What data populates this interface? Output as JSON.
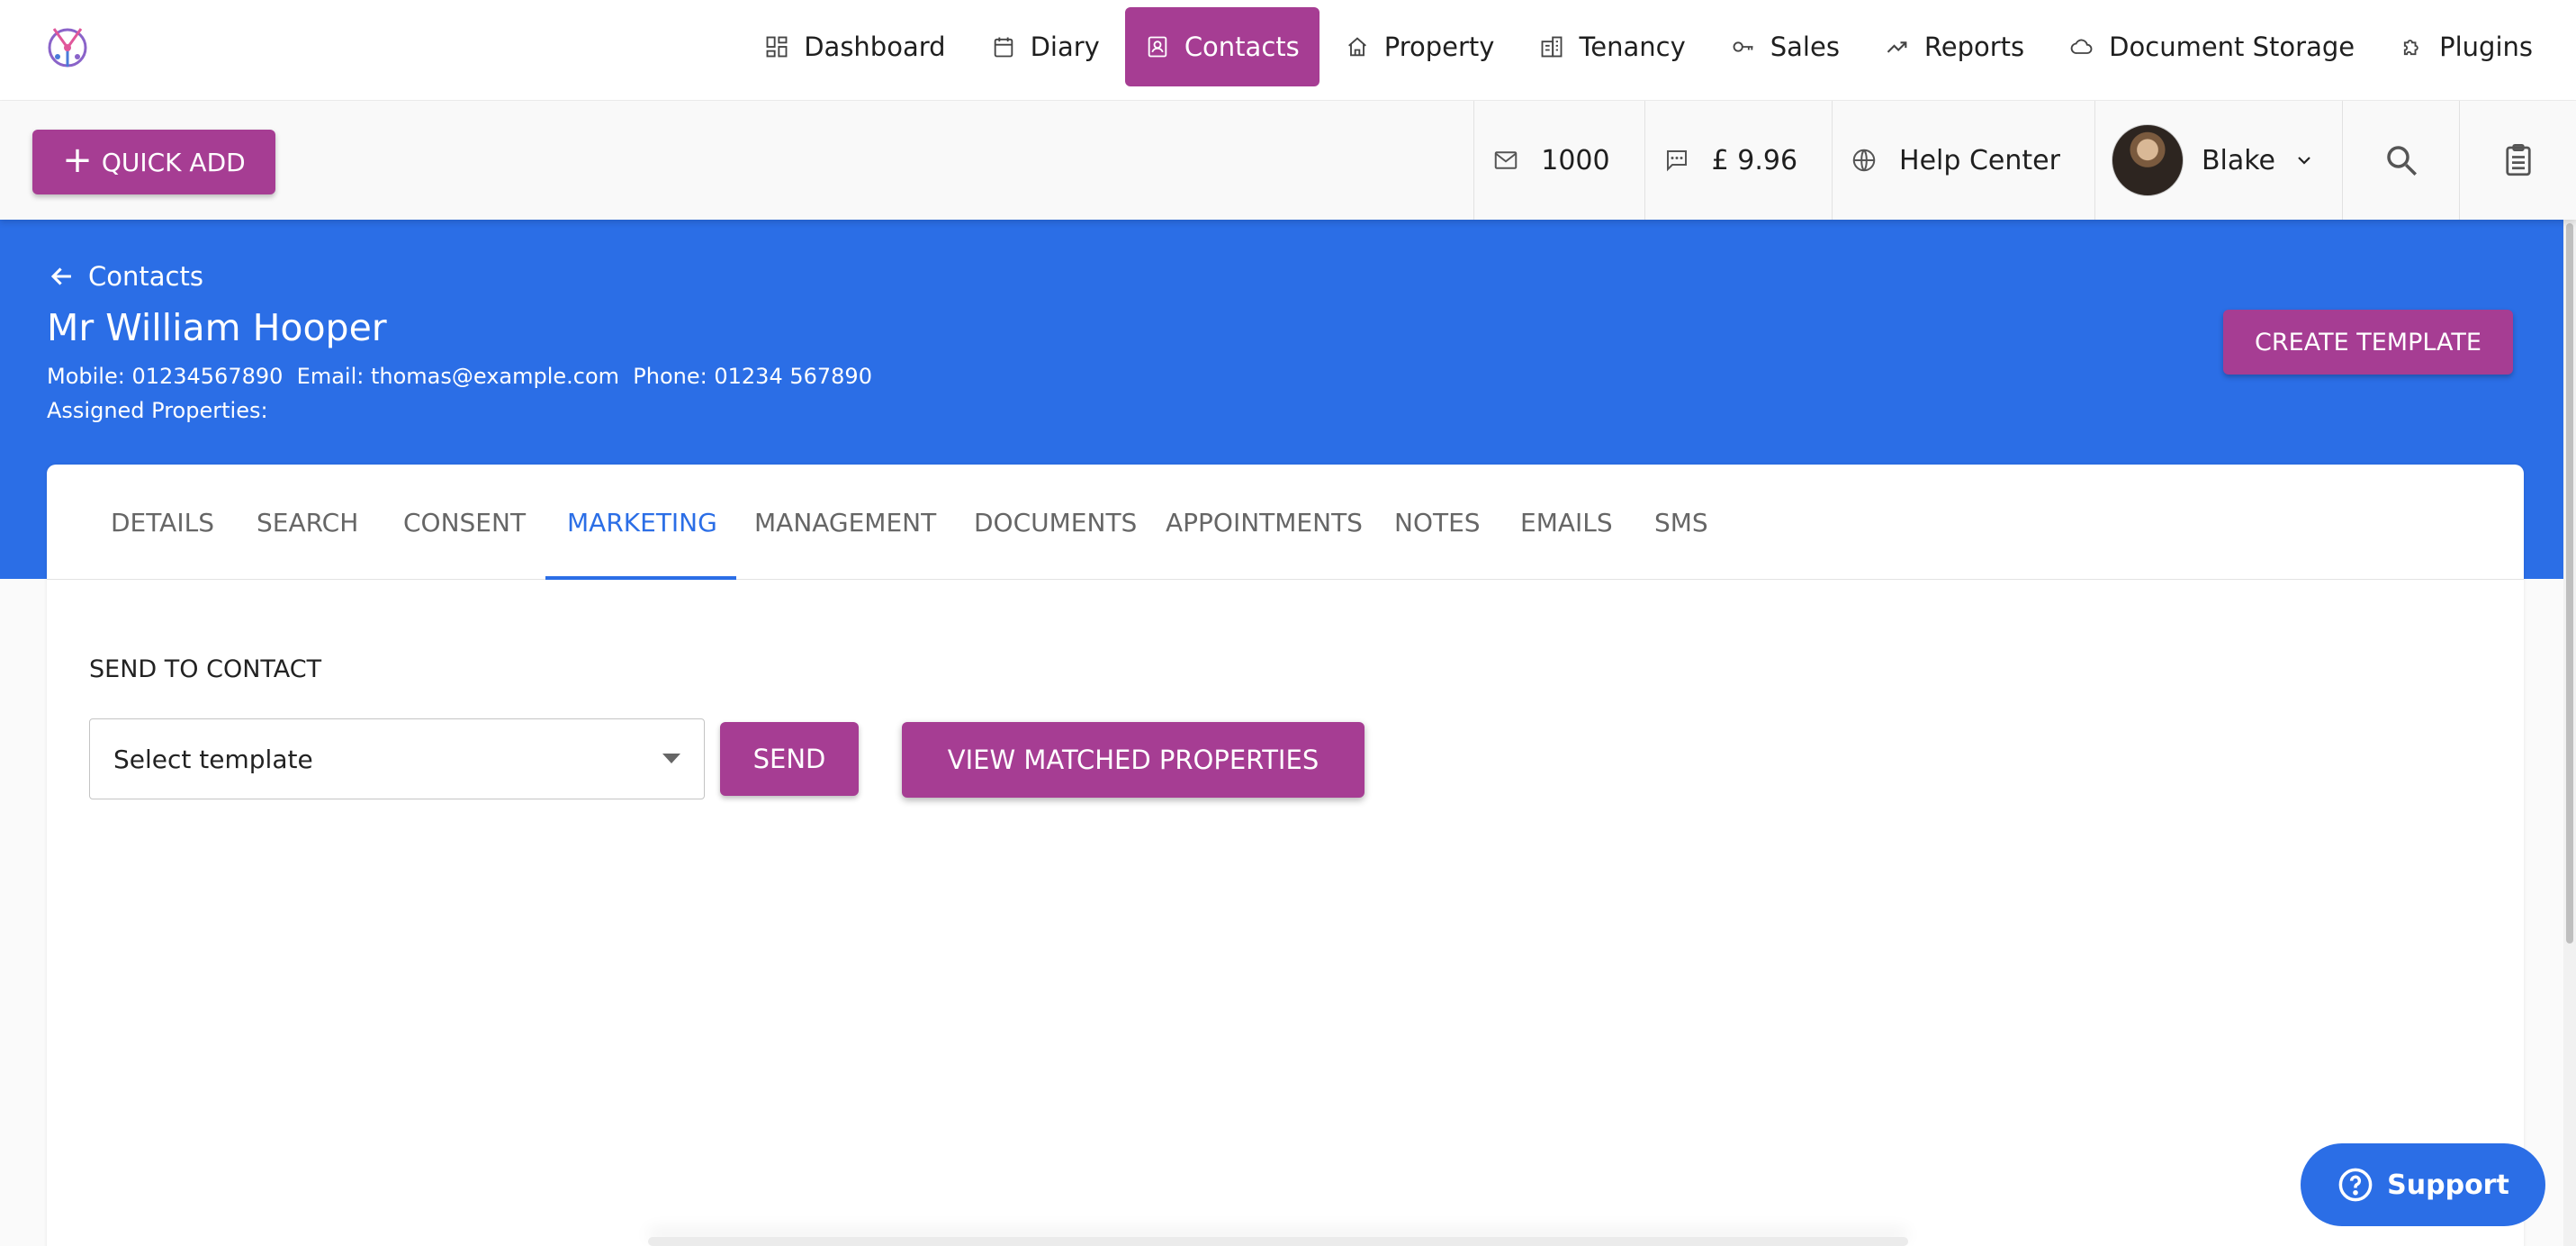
{
  "nav": {
    "items": [
      {
        "label": "Dashboard",
        "icon": "dashboard-icon"
      },
      {
        "label": "Diary",
        "icon": "calendar-icon"
      },
      {
        "label": "Contacts",
        "icon": "contacts-icon",
        "active": true
      },
      {
        "label": "Property",
        "icon": "home-icon"
      },
      {
        "label": "Tenancy",
        "icon": "building-icon"
      },
      {
        "label": "Sales",
        "icon": "key-icon"
      },
      {
        "label": "Reports",
        "icon": "trending-icon"
      },
      {
        "label": "Document Storage",
        "icon": "cloud-icon"
      },
      {
        "label": "Plugins",
        "icon": "puzzle-icon"
      }
    ]
  },
  "toolbar": {
    "quick_add_label": "QUICK ADD",
    "email_credits": "1000",
    "sms_balance": "£ 9.96",
    "help_label": "Help Center",
    "user_name": "Blake"
  },
  "contact": {
    "back_label": "Contacts",
    "name": "Mr William Hooper",
    "meta": "Mobile: 01234567890  Email: thomas@example.com  Phone: 01234 567890",
    "assigned": "Assigned Properties:",
    "create_template_label": "CREATE TEMPLATE"
  },
  "tabs": [
    {
      "label": "DETAILS"
    },
    {
      "label": "SEARCH"
    },
    {
      "label": "CONSENT"
    },
    {
      "label": "MARKETING",
      "active": true
    },
    {
      "label": "MANAGEMENT"
    },
    {
      "label": "DOCUMENTS"
    },
    {
      "label": "APPOINTMENTS"
    },
    {
      "label": "NOTES"
    },
    {
      "label": "EMAILS"
    },
    {
      "label": "SMS"
    }
  ],
  "marketing": {
    "section_label": "SEND TO CONTACT",
    "select_value": "Select template",
    "send_label": "SEND",
    "view_matched_label": "VIEW MATCHED PROPERTIES"
  },
  "support_label": "Support",
  "colors": {
    "primary_blue": "#2b6ee6",
    "accent_magenta": "#a63d93"
  }
}
